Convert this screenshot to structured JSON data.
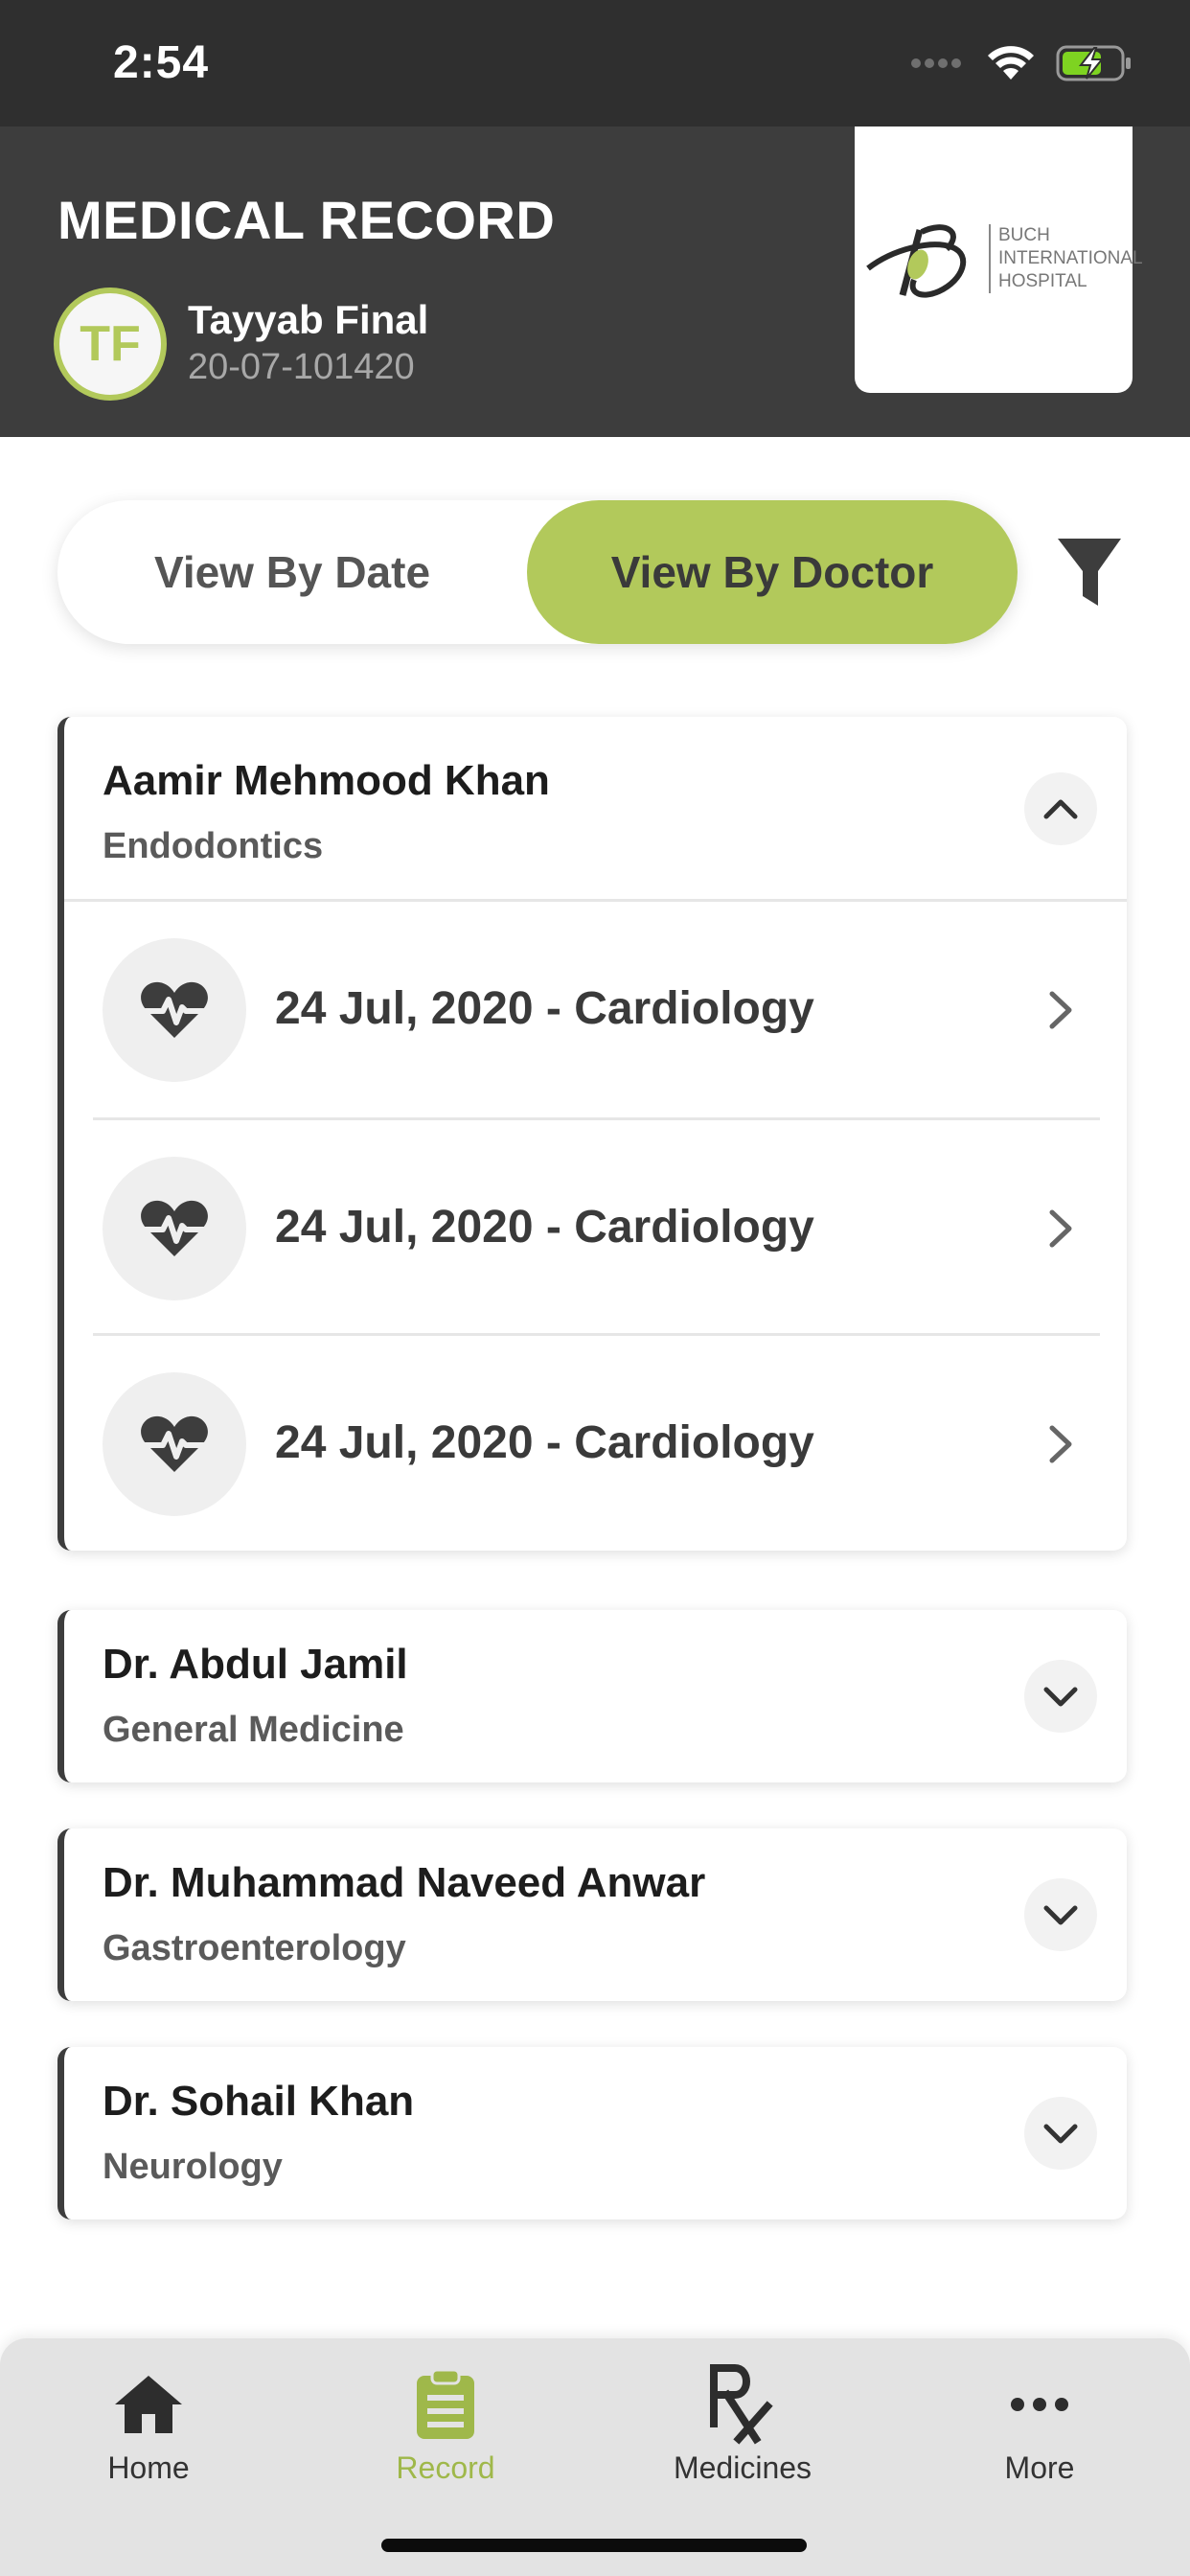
{
  "status_bar": {
    "time": "2:54"
  },
  "header": {
    "title": "MEDICAL RECORD",
    "avatar_initials": "TF",
    "patient_name": "Tayyab Final",
    "patient_id": "20-07-101420",
    "logo_lines": [
      "BUCH",
      "INTERNATIONAL",
      "HOSPITAL"
    ]
  },
  "view_toggle": {
    "by_date": "View By Date",
    "by_doctor": "View By Doctor",
    "selected": "by_doctor"
  },
  "doctors": [
    {
      "name": "Aamir Mehmood Khan",
      "specialty": "Endodontics",
      "expanded": true,
      "records": [
        {
          "label": "24 Jul, 2020 - Cardiology",
          "icon": "heart-pulse-icon"
        },
        {
          "label": "24 Jul, 2020 - Cardiology",
          "icon": "heart-pulse-icon"
        },
        {
          "label": "24 Jul, 2020 - Cardiology",
          "icon": "heart-pulse-icon"
        }
      ]
    },
    {
      "name": "Dr. Abdul  Jamil",
      "specialty": "General Medicine",
      "expanded": false
    },
    {
      "name": "Dr. Muhammad Naveed Anwar",
      "specialty": "Gastroenterology",
      "expanded": false
    },
    {
      "name": "Dr. Sohail  Khan",
      "specialty": "Neurology",
      "expanded": false
    }
  ],
  "tabbar": {
    "tabs": [
      {
        "label": "Home",
        "icon": "home-icon"
      },
      {
        "label": "Record",
        "icon": "clipboard-icon",
        "active": true
      },
      {
        "label": "Medicines",
        "icon": "rx-icon"
      },
      {
        "label": "More",
        "icon": "more-icon"
      }
    ]
  },
  "colors": {
    "accent": "#b2c95b",
    "header_bg": "#3d3d3d",
    "status_bg": "#2f2f2f"
  }
}
